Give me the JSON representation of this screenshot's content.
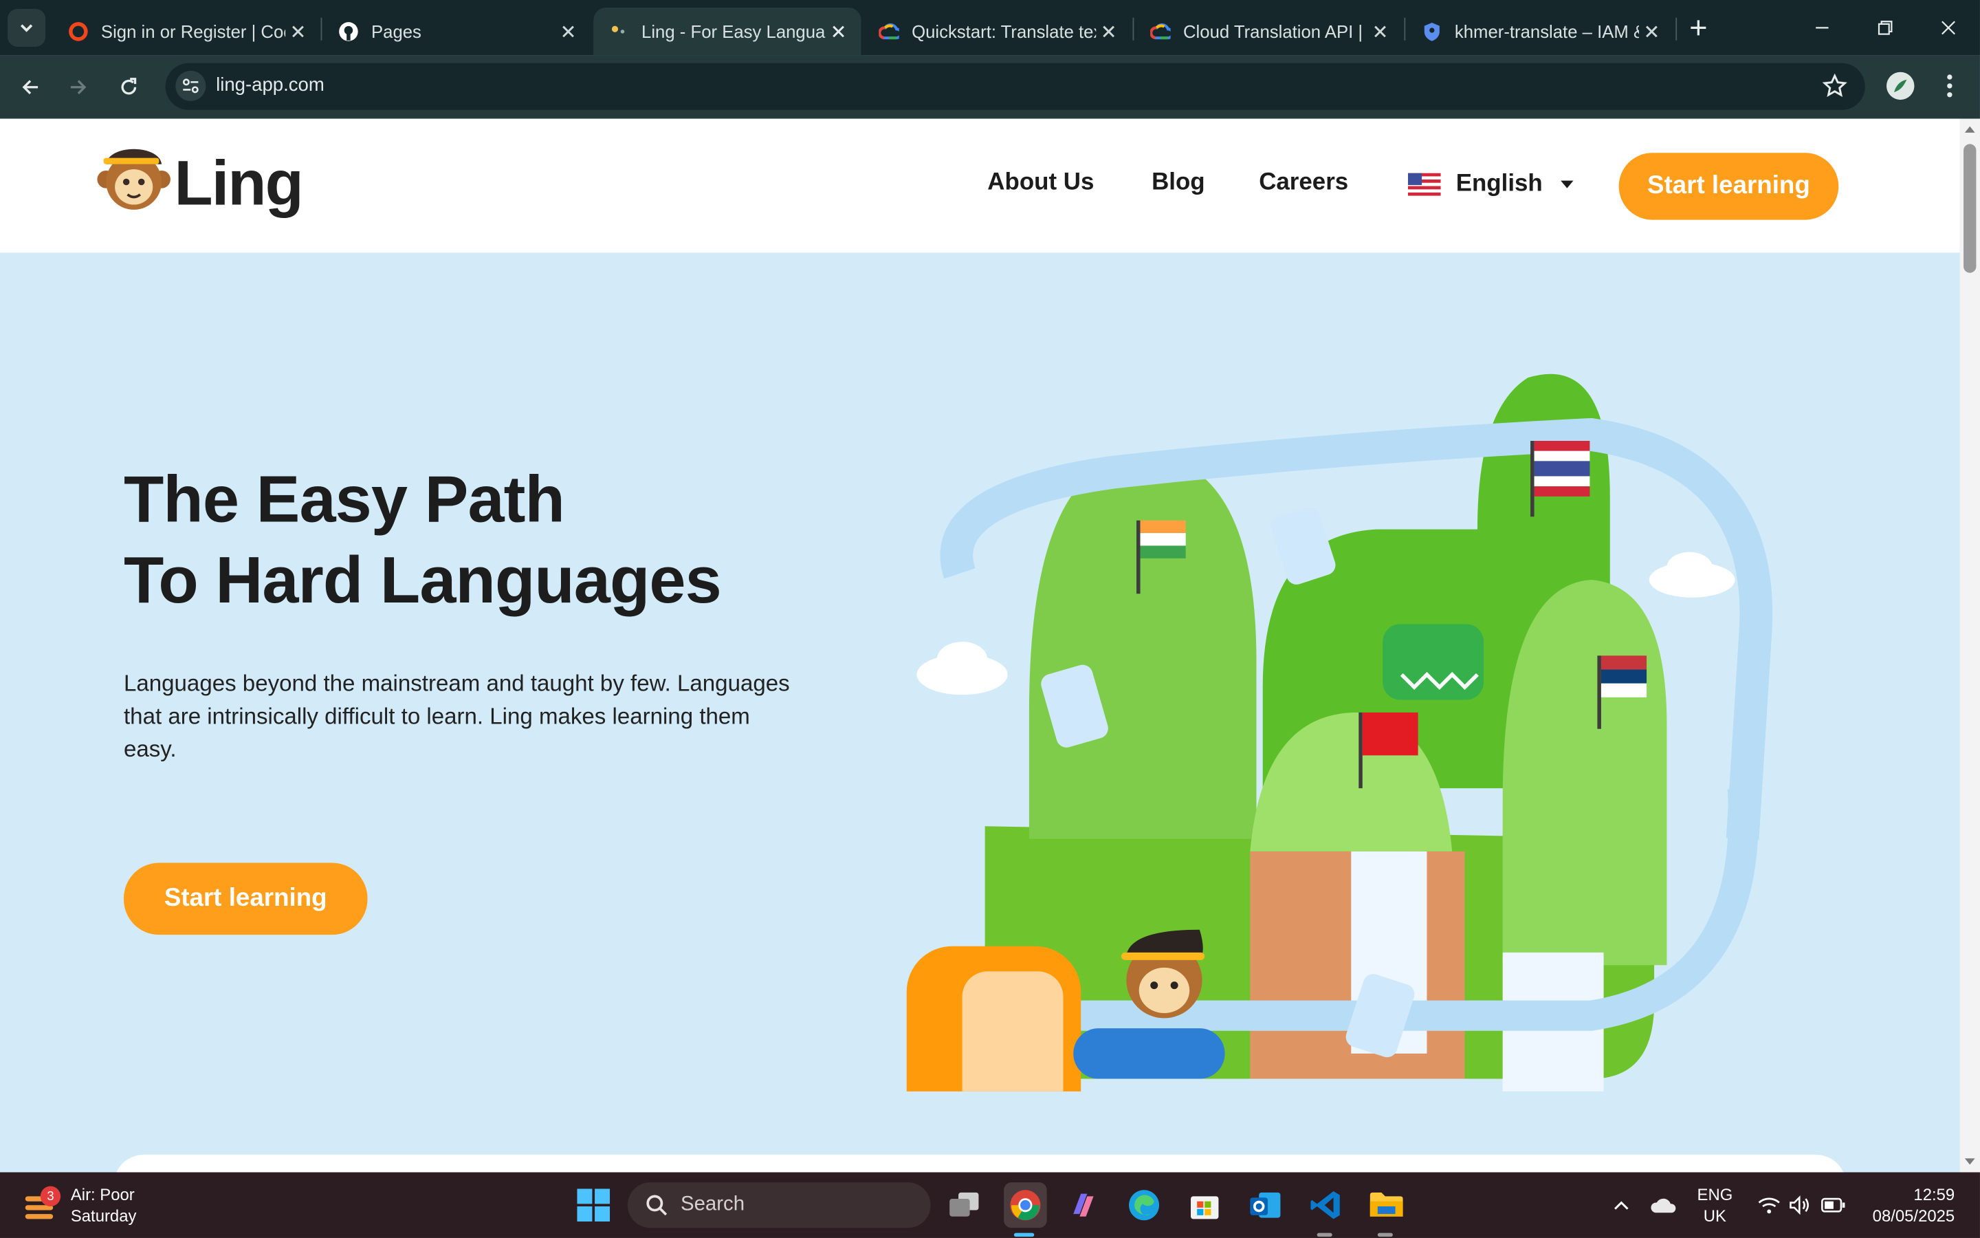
{
  "browser": {
    "tabs": [
      {
        "title": "Sign in or Register | Coc",
        "icon": "opera-circle-icon",
        "active": false
      },
      {
        "title": "Pages",
        "icon": "github-icon",
        "active": false
      },
      {
        "title": "Ling - For Easy Languag",
        "icon": "ling-monkey-icon",
        "active": true
      },
      {
        "title": "Quickstart: Translate tex",
        "icon": "google-cloud-icon",
        "active": false
      },
      {
        "title": "Cloud Translation API |",
        "icon": "google-cloud-icon",
        "active": false
      },
      {
        "title": "khmer-translate – IAM &",
        "icon": "shield-icon",
        "active": false
      }
    ],
    "url": "ling-app.com",
    "colors": {
      "tabstrip": "#15272a",
      "toolbar": "#243a3b",
      "omnibox": "#15272a"
    }
  },
  "site": {
    "logo_text": "Ling",
    "nav": {
      "about": "About Us",
      "blog": "Blog",
      "careers": "Careers",
      "language": "English",
      "cta": "Start learning"
    },
    "hero": {
      "headline_line1": "The Easy Path",
      "headline_line2": "To Hard Languages",
      "subtitle": "Languages beyond the mainstream and taught by few. Languages that are intrinsically difficult to learn. Ling makes learning them easy.",
      "cta": "Start learning"
    },
    "colors": {
      "accent": "#ff9e1b",
      "background": "#d3ebf8",
      "text": "#1d1d1d"
    }
  },
  "taskbar": {
    "weather_badge": "3",
    "weather_line1": "Air: Poor",
    "weather_line2": "Saturday",
    "search_placeholder": "Search",
    "lang_line1": "ENG",
    "lang_line2": "UK",
    "time": "12:59",
    "date": "08/05/2025",
    "apps": [
      "windows-start-icon",
      "search-icon",
      "task-view-icon",
      "chrome-icon",
      "copilot-icon",
      "edge-icon",
      "microsoft-store-icon",
      "outlook-icon",
      "vscode-icon",
      "file-explorer-icon"
    ]
  }
}
